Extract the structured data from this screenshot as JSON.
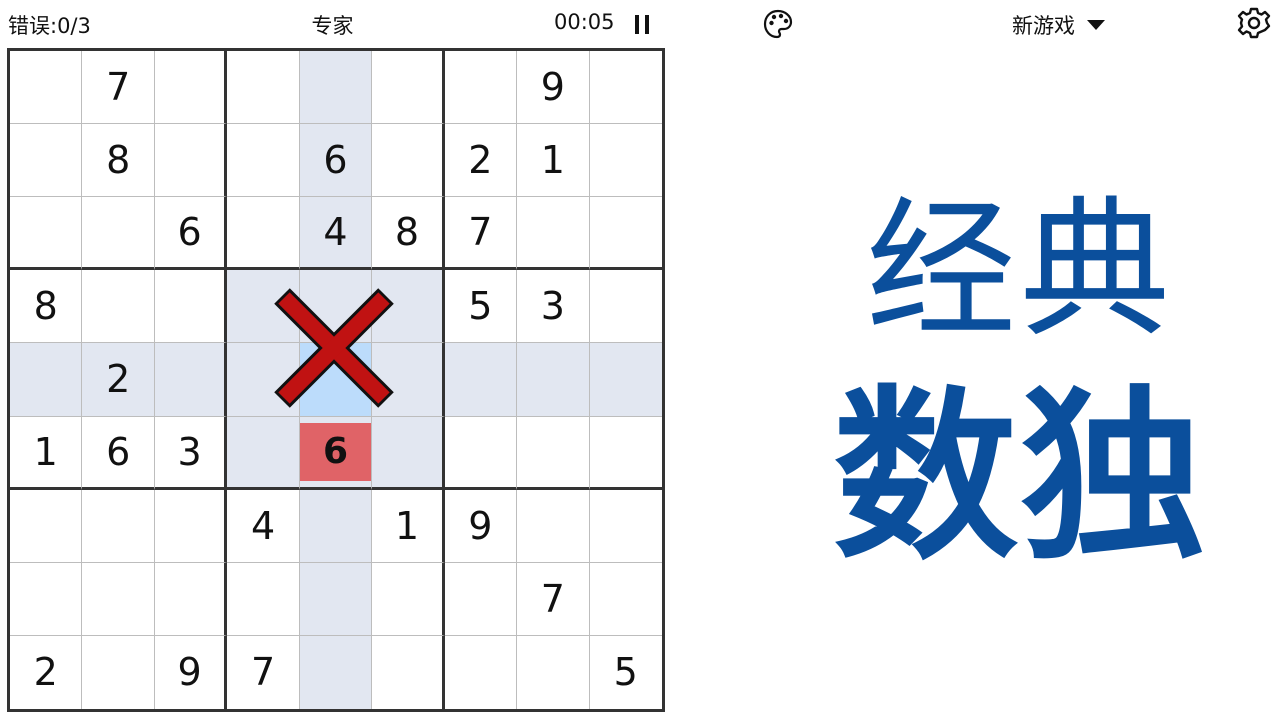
{
  "header": {
    "mistakes": "错误:0/3",
    "difficulty": "专家",
    "timer": "00:05"
  },
  "right_panel": {
    "new_game_label": "新游戏",
    "title_line1": "经典",
    "title_line2": "数独"
  },
  "board": {
    "selected": [
      4,
      4
    ],
    "error_cell": [
      5,
      4
    ],
    "error_value": "6",
    "cells": [
      [
        "",
        "7",
        "",
        "",
        "",
        "",
        "",
        "9",
        ""
      ],
      [
        "",
        "8",
        "",
        "",
        "6",
        "",
        "2",
        "1",
        ""
      ],
      [
        "",
        "",
        "6",
        "",
        "4",
        "8",
        "7",
        "",
        ""
      ],
      [
        "8",
        "",
        "",
        "",
        "",
        "",
        "5",
        "3",
        ""
      ],
      [
        "",
        "2",
        "",
        "",
        "",
        "",
        "",
        "",
        ""
      ],
      [
        "1",
        "6",
        "3",
        "",
        "6",
        "",
        "",
        "",
        ""
      ],
      [
        "",
        "",
        "",
        "4",
        "",
        "1",
        "9",
        "",
        ""
      ],
      [
        "",
        "",
        "",
        "",
        "",
        "",
        "",
        "7",
        ""
      ],
      [
        "2",
        "",
        "9",
        "7",
        "",
        "",
        "",
        "",
        "5"
      ]
    ]
  },
  "icons": {
    "pause": "pause-icon",
    "palette": "palette-icon",
    "dropdown": "chevron-down-icon",
    "settings": "gear-icon",
    "error_mark": "error-x-icon"
  },
  "colors": {
    "highlight": "#e2e7f1",
    "selected": "#bcdcfb",
    "error_fill": "#e06367",
    "error_x": "#c01212",
    "title_blue": "#0b4f9c"
  }
}
